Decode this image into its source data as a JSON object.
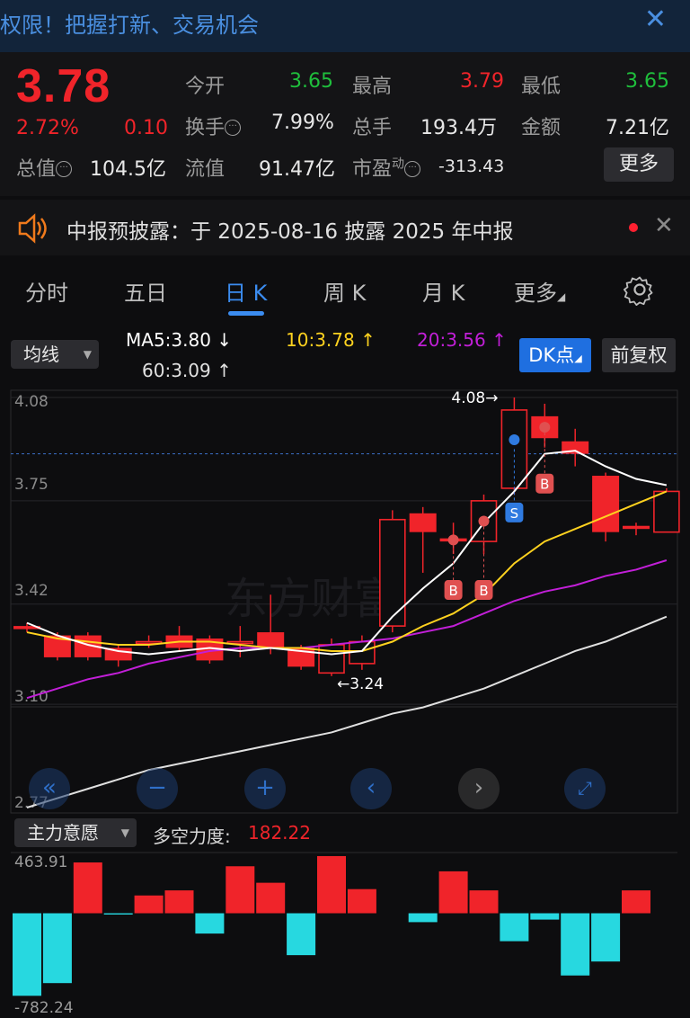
{
  "banner": {
    "text": "权限！把握打新、交易机会",
    "close_icon": "close-icon"
  },
  "quote": {
    "price": "3.78",
    "change_pct": "2.72%",
    "change": "0.10",
    "rows": [
      [
        {
          "label": "今开",
          "value": "3.65",
          "color": "green"
        },
        {
          "label": "最高",
          "value": "3.79",
          "color": "red"
        },
        {
          "label": "最低",
          "value": "3.65",
          "color": "green"
        }
      ],
      [
        {
          "label": "换手",
          "value": "7.99%",
          "color": "normal"
        },
        {
          "label": "总手",
          "value": "193.4万",
          "color": "normal"
        },
        {
          "label": "金额",
          "value": "7.21亿",
          "color": "normal"
        }
      ],
      [
        {
          "label": "总值",
          "value": "104.5亿"
        },
        {
          "label": "流值",
          "value": "91.47亿"
        },
        {
          "label": "市盈",
          "sup": "动",
          "value": "-313.43"
        }
      ]
    ],
    "more_label": "更多"
  },
  "notice": {
    "text": "中报预披露：于 2025-08-16 披露 2025 年中报"
  },
  "tabs": [
    "分时",
    "五日",
    "日 K",
    "周 K",
    "月 K",
    "更多"
  ],
  "active_tab": 2,
  "ma": {
    "selector": "均线",
    "ma5": "MA5:3.80",
    "ma10": "10:3.78",
    "ma20": "20:3.56",
    "ma60": "60:3.09",
    "dk_label": "DK点",
    "fq_label": "前复权"
  },
  "colors": {
    "up": "#f0242a",
    "down": "#1fbf3c",
    "accent": "#3b8cf0",
    "ma5": "#ffffff",
    "ma10": "#ffd21f",
    "ma20": "#c21fd8",
    "ma60": "#e0e0e0",
    "cyan": "#27d8e0"
  },
  "chart_data": {
    "type": "candlestick",
    "ylim": [
      2.77,
      4.08
    ],
    "y_ticks": [
      "4.08",
      "3.75",
      "3.42",
      "3.10",
      "2.77"
    ],
    "annotations": {
      "high": "4.08→",
      "low": "←3.24"
    },
    "watermark": "东方财富",
    "candles": [
      {
        "o": 3.35,
        "c": 3.34,
        "h": 3.36,
        "l": 3.33
      },
      {
        "o": 3.32,
        "c": 3.25,
        "h": 3.33,
        "l": 3.24
      },
      {
        "o": 3.32,
        "c": 3.25,
        "h": 3.33,
        "l": 3.24
      },
      {
        "o": 3.28,
        "c": 3.24,
        "h": 3.29,
        "l": 3.22
      },
      {
        "o": 3.3,
        "c": 3.3,
        "h": 3.32,
        "l": 3.28
      },
      {
        "o": 3.32,
        "c": 3.28,
        "h": 3.35,
        "l": 3.27
      },
      {
        "o": 3.31,
        "c": 3.24,
        "h": 3.32,
        "l": 3.23
      },
      {
        "o": 3.3,
        "c": 3.3,
        "h": 3.35,
        "l": 3.25
      },
      {
        "o": 3.33,
        "c": 3.28,
        "h": 3.45,
        "l": 3.26
      },
      {
        "o": 3.28,
        "c": 3.22,
        "h": 3.29,
        "l": 3.21
      },
      {
        "o": 3.2,
        "c": 3.29,
        "h": 3.31,
        "l": 3.19
      },
      {
        "o": 3.23,
        "c": 3.3,
        "h": 3.32,
        "l": 3.21
      },
      {
        "o": 3.35,
        "c": 3.69,
        "h": 3.72,
        "l": 3.33
      },
      {
        "o": 3.71,
        "c": 3.65,
        "h": 3.73,
        "l": 3.52
      },
      {
        "o": 3.63,
        "c": 3.62,
        "h": 3.68,
        "l": 3.58
      },
      {
        "o": 3.62,
        "c": 3.75,
        "h": 3.77,
        "l": 3.58
      },
      {
        "o": 3.79,
        "c": 4.04,
        "h": 4.08,
        "l": 3.77
      },
      {
        "o": 4.02,
        "c": 3.95,
        "h": 4.06,
        "l": 3.92
      },
      {
        "o": 3.94,
        "c": 3.9,
        "h": 3.98,
        "l": 3.86
      },
      {
        "o": 3.83,
        "c": 3.65,
        "h": 3.84,
        "l": 3.62
      },
      {
        "o": 3.67,
        "c": 3.66,
        "h": 3.68,
        "l": 3.64
      },
      {
        "o": 3.65,
        "c": 3.78,
        "h": 3.79,
        "l": 3.65
      }
    ],
    "ma5": [
      3.36,
      3.32,
      3.29,
      3.27,
      3.26,
      3.27,
      3.28,
      3.27,
      3.28,
      3.27,
      3.26,
      3.27,
      3.38,
      3.47,
      3.55,
      3.68,
      3.78,
      3.9,
      3.91,
      3.86,
      3.82,
      3.8
    ],
    "ma10": [
      3.33,
      3.31,
      3.3,
      3.29,
      3.29,
      3.3,
      3.3,
      3.29,
      3.28,
      3.28,
      3.27,
      3.27,
      3.3,
      3.35,
      3.39,
      3.45,
      3.55,
      3.62,
      3.66,
      3.7,
      3.74,
      3.78
    ],
    "ma20": [
      3.12,
      3.15,
      3.18,
      3.2,
      3.23,
      3.25,
      3.27,
      3.28,
      3.28,
      3.28,
      3.29,
      3.3,
      3.31,
      3.33,
      3.35,
      3.39,
      3.43,
      3.46,
      3.48,
      3.51,
      3.53,
      3.56
    ],
    "ma60": [
      2.77,
      2.8,
      2.83,
      2.86,
      2.89,
      2.91,
      2.93,
      2.95,
      2.97,
      2.99,
      3.01,
      3.04,
      3.07,
      3.09,
      3.12,
      3.15,
      3.19,
      3.23,
      3.27,
      3.3,
      3.34,
      3.38
    ],
    "markers": [
      {
        "i": 14,
        "type": "B"
      },
      {
        "i": 15,
        "type": "B"
      },
      {
        "i": 16,
        "type": "S"
      },
      {
        "i": 17,
        "type": "B"
      }
    ],
    "volume_indicator": {
      "selector": "主力意愿",
      "label": "多空力度:",
      "value": "182.22",
      "ylim": [
        -782.24,
        463.91
      ],
      "y_ticks": [
        "463.91",
        "-782.24"
      ],
      "values": [
        -650,
        -550,
        400,
        -10,
        140,
        180,
        -160,
        370,
        240,
        -330,
        450,
        190,
        0,
        -70,
        330,
        180,
        -220,
        -50,
        -490,
        -380,
        180,
        0
      ]
    }
  },
  "nav_buttons": [
    "rewind-icon",
    "zoom-out-icon",
    "zoom-in-icon",
    "prev-icon",
    "next-icon",
    "fullscreen-icon"
  ]
}
